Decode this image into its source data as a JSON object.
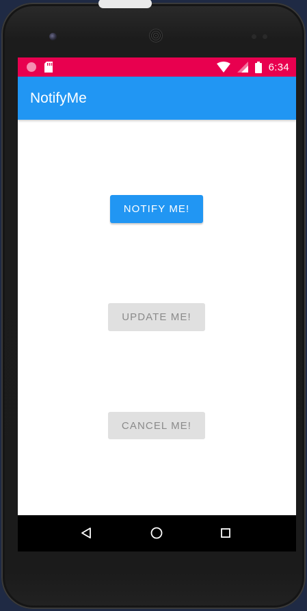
{
  "status_bar": {
    "time": "6:34",
    "background": "#E8004F",
    "icons": [
      "circle-notification-icon",
      "sd-card-icon",
      "wifi-icon",
      "signal-icon",
      "battery-icon"
    ]
  },
  "app_bar": {
    "title": "NotifyMe",
    "background": "#2196F3"
  },
  "buttons": {
    "notify": {
      "label": "NOTIFY ME!",
      "background": "#2196F3",
      "color": "#FFFFFF",
      "enabled": true
    },
    "update": {
      "label": "UPDATE ME!",
      "background": "#E0E0E0",
      "color": "#8A8A8A",
      "enabled": false
    },
    "cancel": {
      "label": "CANCEL ME!",
      "background": "#E0E0E0",
      "color": "#8A8A8A",
      "enabled": false
    }
  },
  "nav_bar": {
    "icons": [
      "back-icon",
      "home-icon",
      "recents-icon"
    ]
  }
}
